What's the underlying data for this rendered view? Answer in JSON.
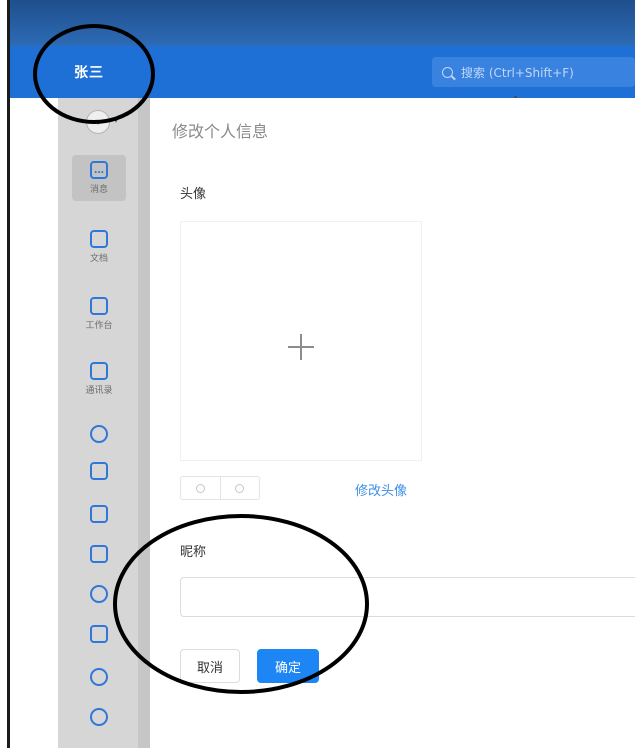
{
  "header": {
    "user_name": "张三",
    "search_placeholder": "搜索 (Ctrl+Shift+F)"
  },
  "sidebar": {
    "items": [
      {
        "label": "消息",
        "icon": "message-icon",
        "glyph": "…",
        "active": true
      },
      {
        "label": "文档",
        "icon": "document-icon",
        "glyph": "",
        "active": false
      },
      {
        "label": "工作台",
        "icon": "workbench-icon",
        "glyph": "",
        "active": false
      },
      {
        "label": "通讯录",
        "icon": "contacts-icon",
        "glyph": "",
        "active": false
      },
      {
        "label": "",
        "icon": "cloud-icon",
        "glyph": "",
        "active": false
      },
      {
        "label": "",
        "icon": "calendar-icon",
        "glyph": "",
        "active": false
      },
      {
        "label": "",
        "icon": "todo-icon",
        "glyph": "",
        "active": false
      },
      {
        "label": "",
        "icon": "lightning-icon",
        "glyph": "",
        "active": false
      },
      {
        "label": "",
        "icon": "settings-icon",
        "glyph": "",
        "active": false
      },
      {
        "label": "",
        "icon": "mail-icon",
        "glyph": "",
        "active": false
      },
      {
        "label": "",
        "icon": "phone-icon",
        "glyph": "",
        "active": false
      },
      {
        "label": "",
        "icon": "more-icon",
        "glyph": "",
        "active": false
      }
    ]
  },
  "main": {
    "page_title": "修改个人信息",
    "avatar_label": "头像",
    "change_avatar_link": "修改头像",
    "nickname_label": "昵称",
    "nickname_value": "",
    "cancel_label": "取消",
    "confirm_label": "确定"
  },
  "colors": {
    "titlebar": "#1e6fd6",
    "sidebar": "#d6d6d6",
    "accent": "#1e86f4",
    "link": "#3f8ee8"
  }
}
